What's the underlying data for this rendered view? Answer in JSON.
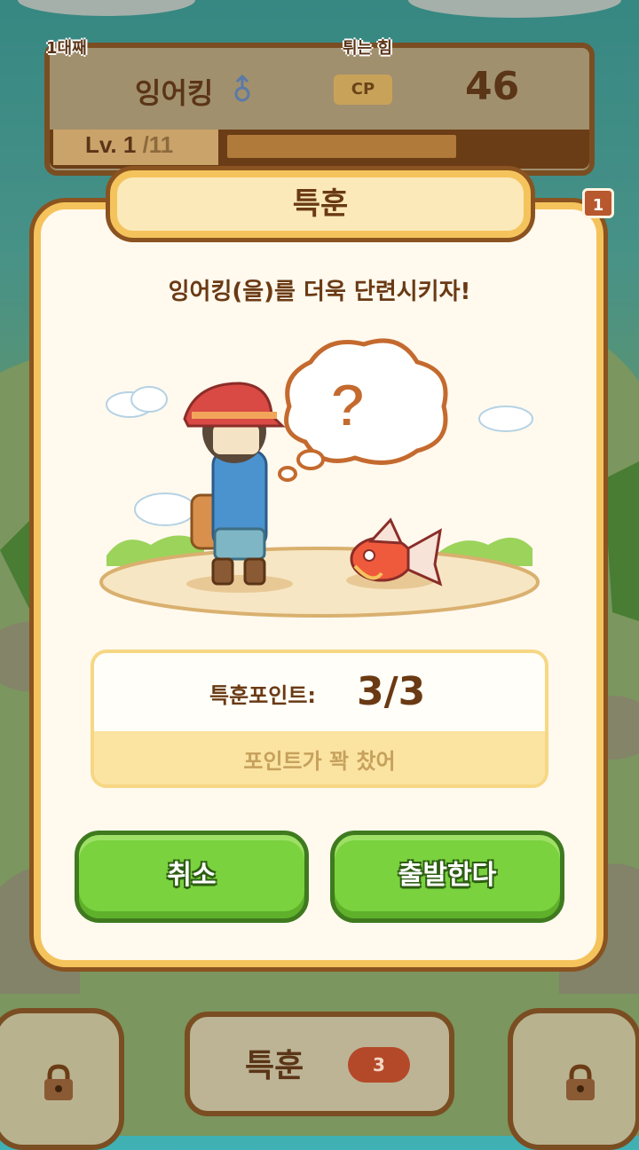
{
  "status": {
    "rank_label": "1대째",
    "trait_label": "튀는 힘",
    "pokemon_name": "잉어킹",
    "gender_icon": "male-icon",
    "cp_label": "CP",
    "cp_value": "46",
    "level_label": "Lv. 1",
    "level_max": "/11",
    "exp_fraction": 0.5
  },
  "dialog": {
    "title": "특훈",
    "notification_count": "1",
    "message": "잉어킹(을)를 더욱 단련시키자!",
    "points_label": "특훈포인트:",
    "points_value": "3/3",
    "points_note": "포인트가 꽉 찼어",
    "cancel_label": "취소",
    "go_label": "출발한다"
  },
  "nav": {
    "center_title": "특훈",
    "center_count": "3",
    "left_icon": "lock-icon",
    "right_icon": "lock-icon"
  },
  "colors": {
    "frame_brown": "#7a4e22",
    "dialog_yellow": "#f5c35c",
    "button_green": "#79d23e",
    "text_brown": "#6a3a14"
  }
}
